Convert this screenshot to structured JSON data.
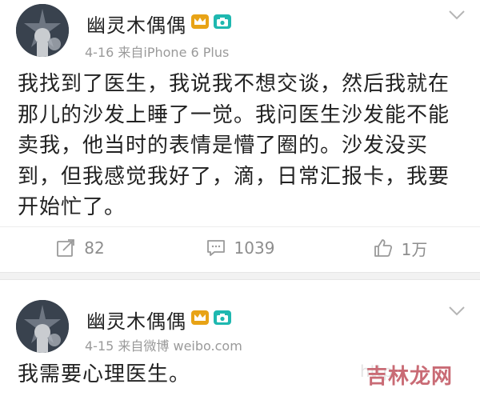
{
  "colors": {
    "badge_gold": "#e8a316",
    "badge_teal": "#1fb8b0",
    "meta_gray": "#9a9a9a",
    "watermark": "#c96b75"
  },
  "post1": {
    "author": "幽灵木偶偶",
    "meta": "4-16  来自iPhone 6 Plus",
    "text": "我找到了医生，我说我不想交谈，然后我就在那儿的沙发上睡了一觉。我问医生沙发能不能卖我，他当时的表情是懵了圈的。沙发没买到，但我感觉我好了，滴，日常汇报卡，我要开始忙了。",
    "actions": {
      "repost": {
        "icon": "repost-icon",
        "count": "82"
      },
      "comment": {
        "icon": "comment-icon",
        "count": "1039"
      },
      "like": {
        "icon": "like-icon",
        "count": "1万"
      }
    }
  },
  "post2": {
    "author": "幽灵木偶偶",
    "meta": "4-15  来自微博 weibo.com",
    "text": "我需要心理医生。"
  },
  "watermark": {
    "faded": "http",
    "main": "吉林龙网"
  }
}
